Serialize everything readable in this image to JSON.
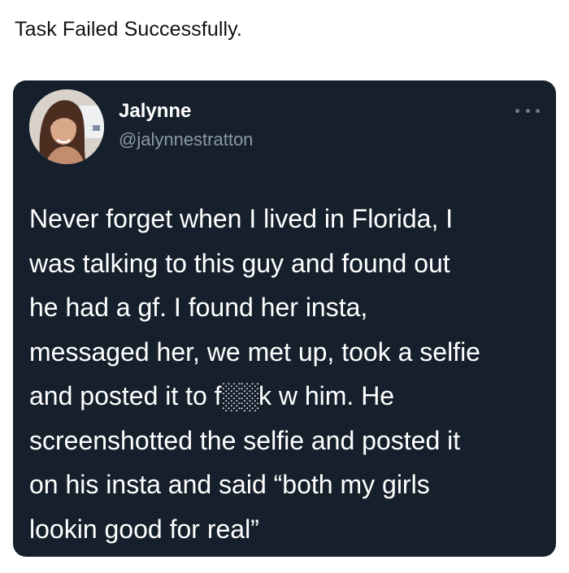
{
  "caption": "Task Failed Successfully.",
  "tweet": {
    "display_name": "Jalynne",
    "handle": "@jalynnestratton",
    "more_icon": "more-horizontal-icon",
    "text": "Never forget when I lived in Florida, I\nwas talking to this guy and found out\nhe had a gf. I found her insta,\nmessaged her, we met up, took a selfie\nand posted it to f░░k w him. He\nscreenshotted the selfie and posted it\non his insta and said “both my girls\nlookin good for real”"
  },
  "colors": {
    "card_background": "#16202c",
    "handle_gray": "#8b98a5",
    "text_white": "#ffffff"
  }
}
